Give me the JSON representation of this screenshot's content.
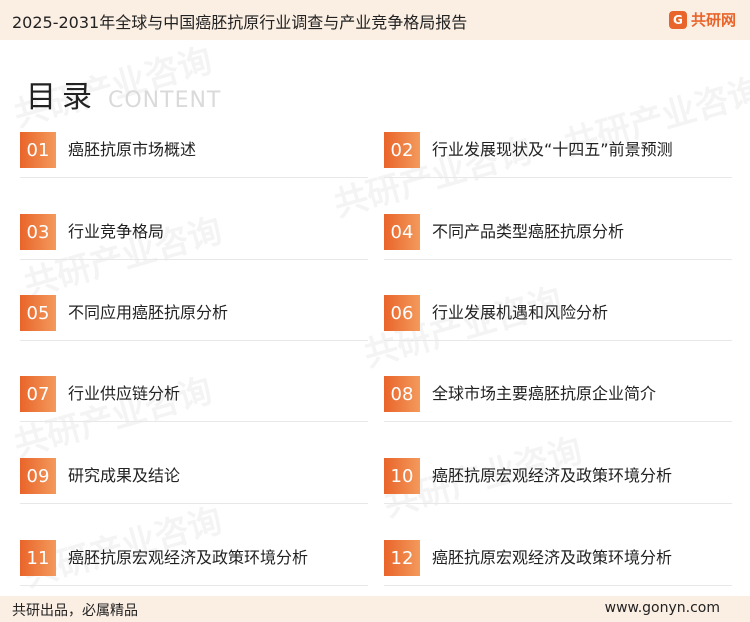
{
  "header": {
    "title": "2025-2031年全球与中国癌胚抗原行业调查与产业竞争格局报告",
    "brand": "共研网",
    "brand_icon": "G"
  },
  "heading": {
    "main": "目录",
    "sub": "CONTENT"
  },
  "watermark_text": "共研产业咨询",
  "toc": [
    {
      "num": "01",
      "label": "癌胚抗原市场概述"
    },
    {
      "num": "02",
      "label": "行业发展现状及“十四五”前景预测"
    },
    {
      "num": "03",
      "label": "行业竞争格局"
    },
    {
      "num": "04",
      "label": "不同产品类型癌胚抗原分析"
    },
    {
      "num": "05",
      "label": "不同应用癌胚抗原分析"
    },
    {
      "num": "06",
      "label": "行业发展机遇和风险分析"
    },
    {
      "num": "07",
      "label": "行业供应链分析"
    },
    {
      "num": "08",
      "label": "全球市场主要癌胚抗原企业简介"
    },
    {
      "num": "09",
      "label": "研究成果及结论"
    },
    {
      "num": "10",
      "label": "癌胚抗原宏观经济及政策环境分析"
    },
    {
      "num": "11",
      "label": "癌胚抗原宏观经济及政策环境分析"
    },
    {
      "num": "12",
      "label": "癌胚抗原宏观经济及政策环境分析"
    }
  ],
  "footer": {
    "left": "共研出品，必属精品",
    "right": "www.gonyn.com"
  },
  "colors": {
    "accent": "#e9642a",
    "accent_light": "#f39a5c",
    "bar_bg": "#fbeee3"
  }
}
